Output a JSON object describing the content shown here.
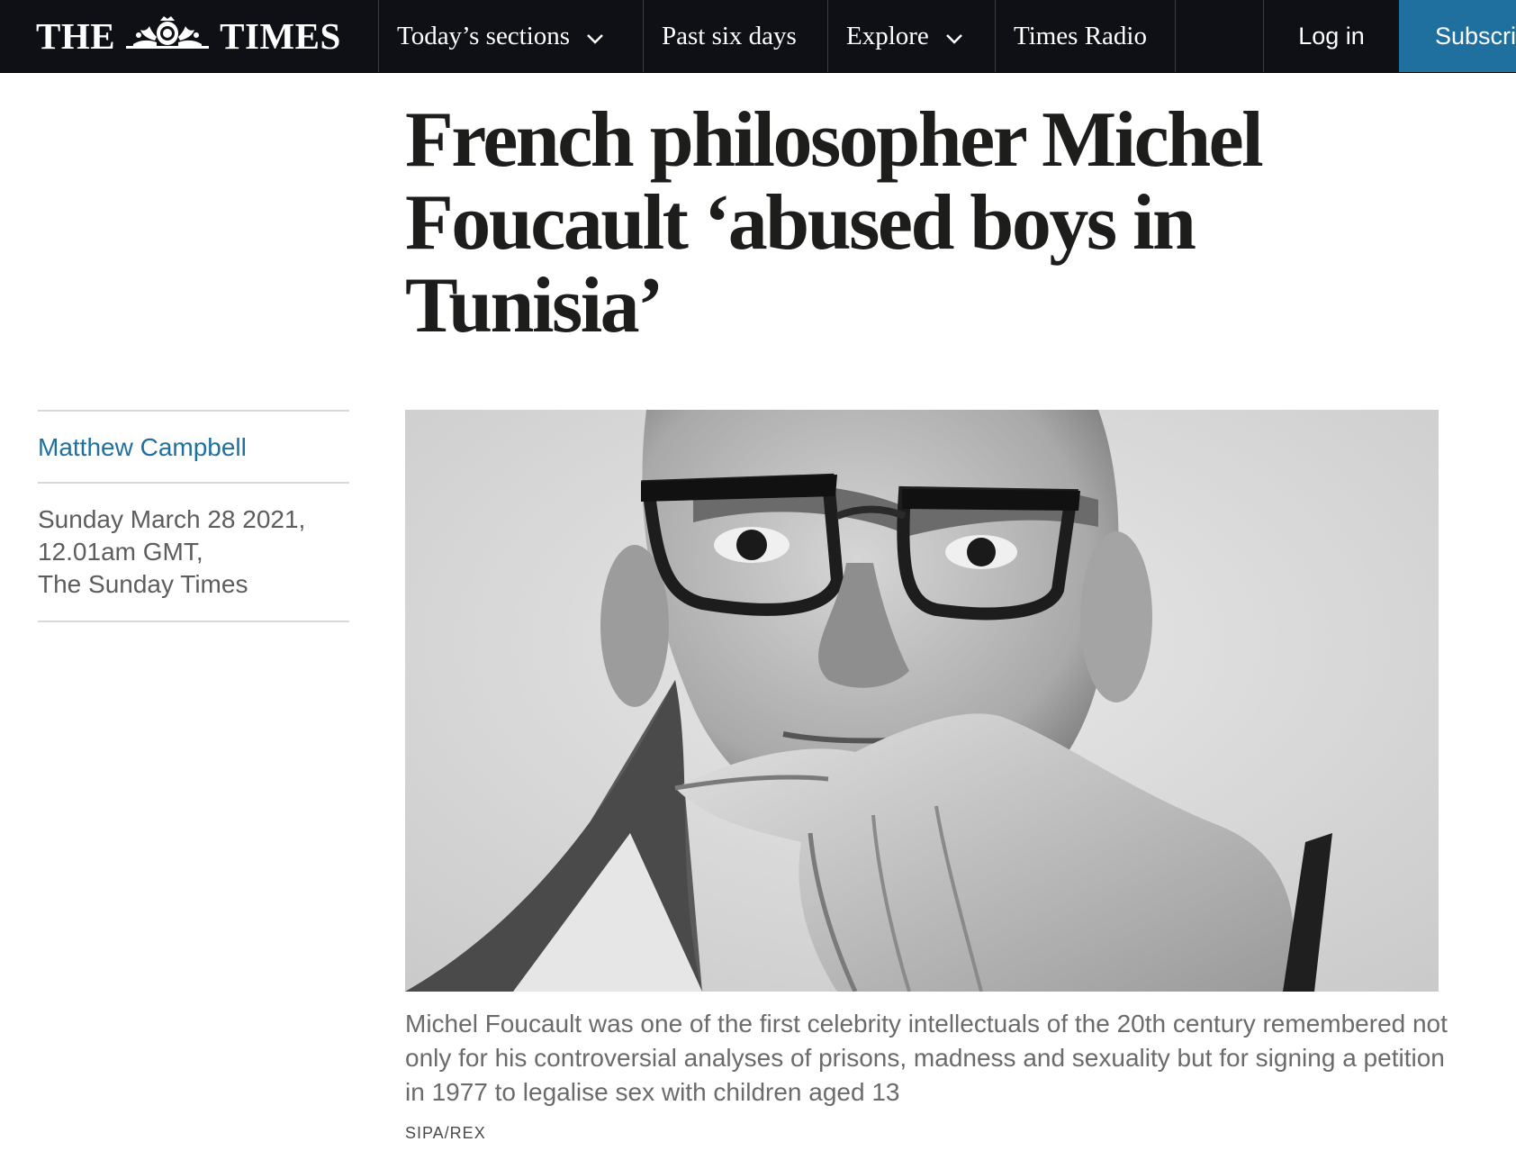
{
  "nav": {
    "brand_left": "THE",
    "brand_right": "TIMES",
    "items": [
      {
        "label": "Today’s sections",
        "has_dropdown": true
      },
      {
        "label": "Past six days",
        "has_dropdown": false
      },
      {
        "label": "Explore",
        "has_dropdown": true
      },
      {
        "label": "Times Radio",
        "has_dropdown": false
      }
    ],
    "login": "Log in",
    "subscribe": "Subscribe",
    "colors": {
      "bar": "#0f1016",
      "subscribe_bg": "#1f6f9f"
    }
  },
  "article": {
    "headline": "French philosopher Michel Foucault ‘abused boys in Tunisia’",
    "author": "Matthew Campbell",
    "date": "Sunday March 28 2021,",
    "time": "12.01am GMT,",
    "publication": "The Sunday Times",
    "image": {
      "subject": "portrait-photo",
      "caption": "Michel Foucault was one of the first celebrity intellectuals of the 20th century remembered not only for his controversial analyses of prisons, madness and sexuality but for signing a petition in 1977 to legalise sex with children aged 13",
      "credit": "SIPA/REX"
    },
    "colors": {
      "author_link": "#1f6f9f",
      "headline": "#1d1d1b"
    }
  }
}
